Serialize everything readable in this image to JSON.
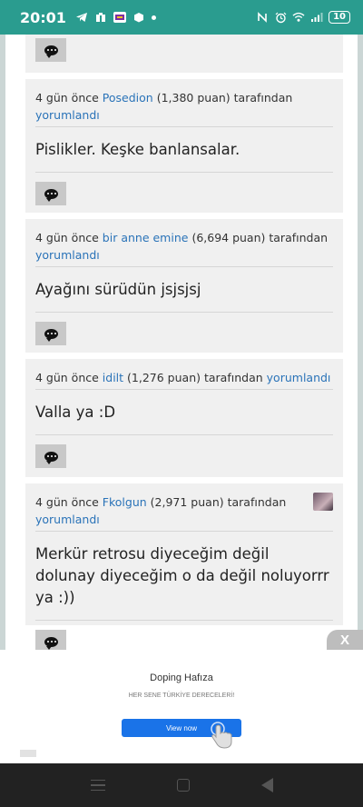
{
  "status_bar": {
    "time": "20:01",
    "battery": "10",
    "icons_left": [
      "telegram-icon",
      "app-icon-2",
      "app-icon-3",
      "box-icon",
      "notification-dot"
    ],
    "icons_right": [
      "nfc-icon",
      "alarm-icon",
      "wifi-icon",
      "signal-icon",
      "battery-icon"
    ]
  },
  "comments": [
    {
      "time": "4 gün önce",
      "user": "Posedion",
      "points": "(1,380 puan)",
      "by": "tarafından",
      "action": "yorumlandı",
      "text": "Pislikler. Keşke banlansalar."
    },
    {
      "time": "4 gün önce",
      "user": "bir anne emine",
      "points": "(6,694 puan)",
      "by": "tarafından",
      "action": "yorumlandı",
      "text": "Ayağını sürüdün jsjsjsj"
    },
    {
      "time": "4 gün önce",
      "user": "idilt",
      "points": "(1,276 puan)",
      "by": "tarafından",
      "action": "yorumlandı",
      "text": "Valla ya :D"
    },
    {
      "time": "4 gün önce",
      "user": "Fkolgun",
      "points": "(2,971 puan)",
      "by": "tarafından",
      "action": "yorumlandı",
      "text": "Merkür retrosu diyeceğim değil dolunay diyeceğim o da değil noluyorrr ya :))"
    }
  ],
  "ad": {
    "close": "X",
    "title": "Doping Hafıza",
    "subtitle": "HER SENE TÜRKİYE DERECELERİ!",
    "button": "View now"
  },
  "colors": {
    "status_bar": "#2a9c8f",
    "card": "#f0f0f0",
    "link": "#2a73b8",
    "ad_button": "#1a73e8"
  }
}
